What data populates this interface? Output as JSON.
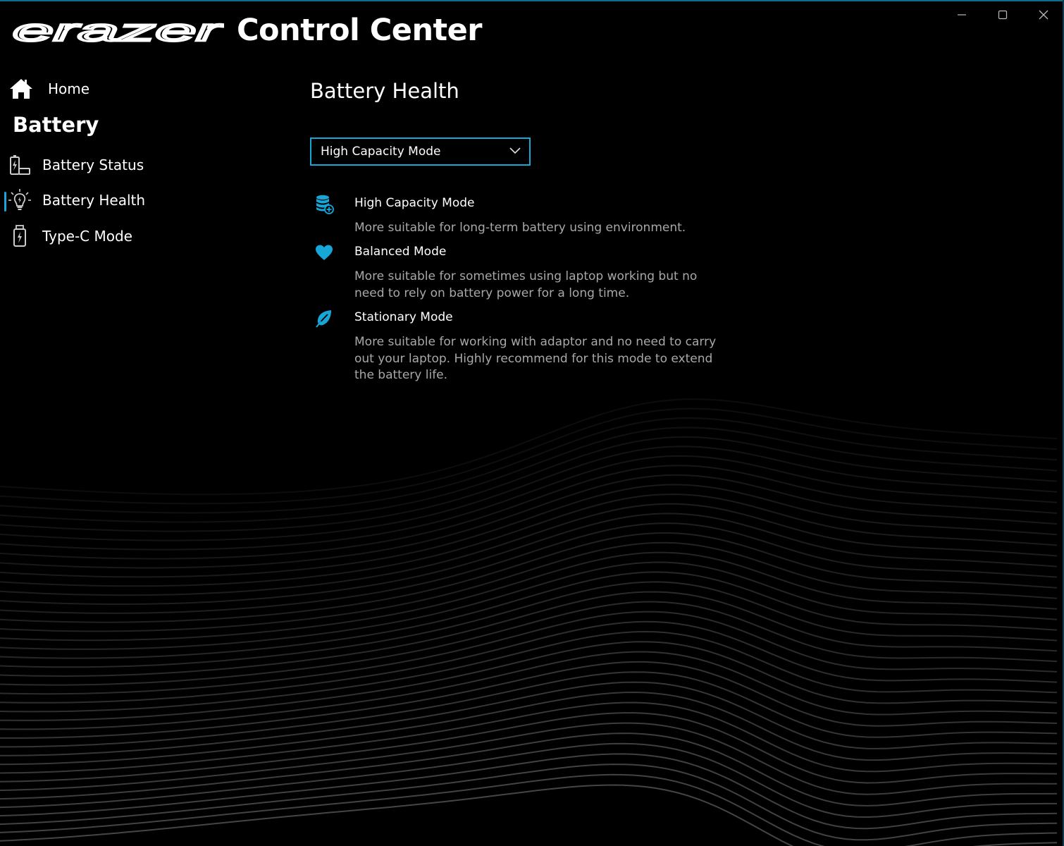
{
  "window": {
    "brand": "erazer",
    "title": "Control Center",
    "controls": {
      "minimize": "minimize-icon",
      "maximize": "maximize-icon",
      "close": "close-icon"
    }
  },
  "sidebar": {
    "home": {
      "label": "Home",
      "icon": "home-icon"
    },
    "section": "Battery",
    "items": [
      {
        "label": "Battery Status",
        "icon": "battery-status-icon"
      },
      {
        "label": "Battery Health",
        "icon": "battery-health-icon",
        "selected": true
      },
      {
        "label": "Type-C Mode",
        "icon": "type-c-icon"
      }
    ]
  },
  "main": {
    "title": "Battery Health",
    "dropdown": {
      "selected": "High Capacity Mode"
    },
    "modes": [
      {
        "name": "High Capacity Mode",
        "icon": "database-icon",
        "description": "More suitable for long-term battery using environment."
      },
      {
        "name": "Balanced Mode",
        "icon": "heart-icon",
        "description": "More suitable for sometimes using laptop working but no need to rely on battery power for a long time."
      },
      {
        "name": "Stationary Mode",
        "icon": "leaf-icon",
        "description": "More suitable for working with adaptor and no need to carry out your laptop. Highly recommend for this mode to extend the battery life."
      }
    ]
  },
  "colors": {
    "accent": "#16a6d8",
    "background": "#000000",
    "text": "#ffffff",
    "muted": "#a8a8a8"
  }
}
